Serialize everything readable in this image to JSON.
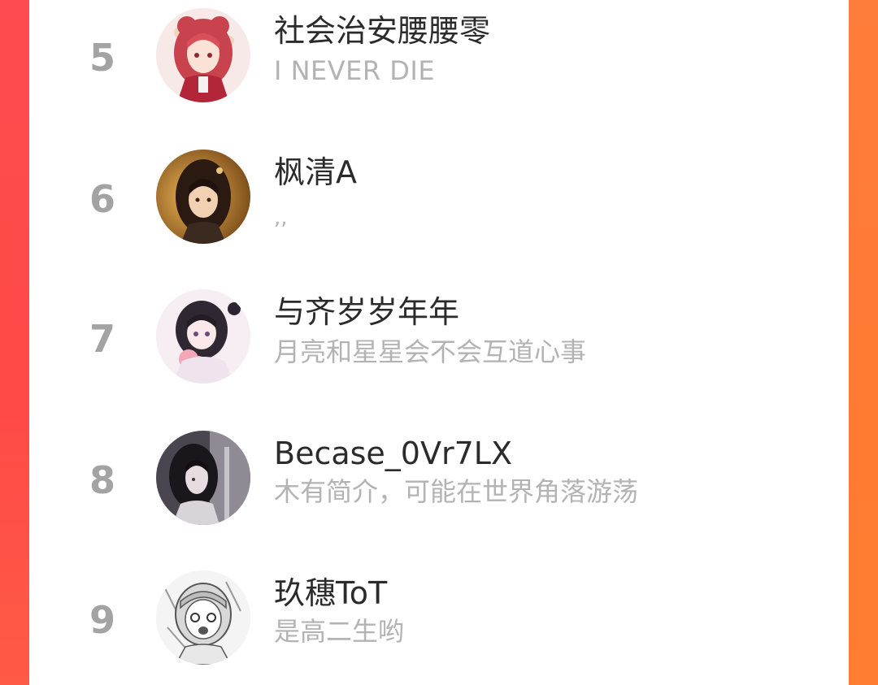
{
  "ranking": {
    "items": [
      {
        "rank": "5",
        "name": "社会治安腰腰零",
        "bio": "I NEVER DIE",
        "avatar_icon": "avatar-red-hair-girl"
      },
      {
        "rank": "6",
        "name": "枫清A",
        "bio": ",,",
        "avatar_icon": "avatar-dark-hair-girl-golden"
      },
      {
        "rank": "7",
        "name": "与齐岁岁年年",
        "bio": "月亮和星星会不会互道心事",
        "avatar_icon": "avatar-girl-holding-flowers"
      },
      {
        "rank": "8",
        "name": "Becase_0Vr7LX",
        "bio": "木有简介，可能在世界角落游荡",
        "avatar_icon": "avatar-girl-in-shadow"
      },
      {
        "rank": "9",
        "name": "玖穗ToT",
        "bio": "是高二生哟",
        "avatar_icon": "avatar-manga-girl-sketch"
      }
    ]
  },
  "colors": {
    "accent_left": "#ff4a4a",
    "accent_right": "#ff7a36",
    "rank_gray": "#a3a3a3",
    "name_text": "#2b2b2b",
    "bio_text": "#b3b3b3"
  }
}
